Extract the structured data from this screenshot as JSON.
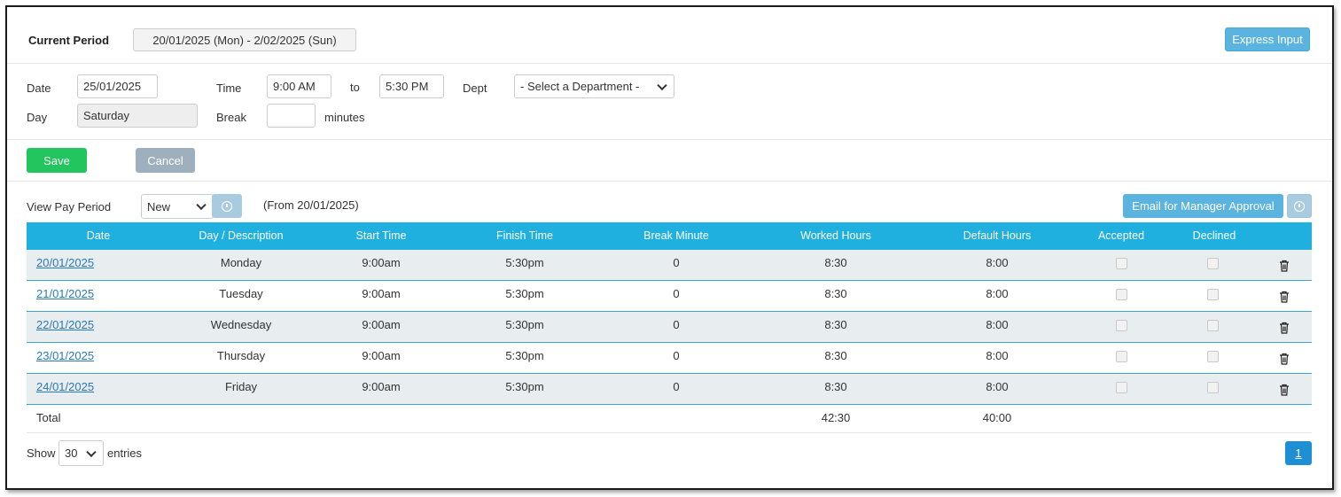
{
  "header": {
    "current_period_label": "Current Period",
    "current_period_value": "20/01/2025 (Mon) - 2/02/2025 (Sun)",
    "express_input": "Express Input"
  },
  "form": {
    "date_label": "Date",
    "date_value": "25/01/2025",
    "day_label": "Day",
    "day_value": "Saturday",
    "time_label": "Time",
    "time_start": "9:00 AM",
    "to_label": "to",
    "time_end": "5:30 PM",
    "dept_label": "Dept",
    "dept_value": "- Select a Department -",
    "break_label": "Break",
    "break_value": "",
    "minutes_label": "minutes"
  },
  "actions": {
    "save": "Save",
    "cancel": "Cancel"
  },
  "pay_period": {
    "label": "View Pay Period",
    "selected": "New",
    "from_text": "(From 20/01/2025)",
    "email_button": "Email for Manager Approval"
  },
  "table": {
    "headers": [
      "Date",
      "Day / Description",
      "Start Time",
      "Finish Time",
      "Break Minute",
      "Worked Hours",
      "Default Hours",
      "Accepted",
      "Declined"
    ],
    "rows": [
      {
        "date": "20/01/2025",
        "day": "Monday",
        "start": "9:00am",
        "finish": "5:30pm",
        "break": "0",
        "worked": "8:30",
        "default": "8:00"
      },
      {
        "date": "21/01/2025",
        "day": "Tuesday",
        "start": "9:00am",
        "finish": "5:30pm",
        "break": "0",
        "worked": "8:30",
        "default": "8:00"
      },
      {
        "date": "22/01/2025",
        "day": "Wednesday",
        "start": "9:00am",
        "finish": "5:30pm",
        "break": "0",
        "worked": "8:30",
        "default": "8:00"
      },
      {
        "date": "23/01/2025",
        "day": "Thursday",
        "start": "9:00am",
        "finish": "5:30pm",
        "break": "0",
        "worked": "8:30",
        "default": "8:00"
      },
      {
        "date": "24/01/2025",
        "day": "Friday",
        "start": "9:00am",
        "finish": "5:30pm",
        "break": "0",
        "worked": "8:30",
        "default": "8:00"
      }
    ],
    "total_label": "Total",
    "total_worked": "42:30",
    "total_default": "40:00"
  },
  "footer": {
    "show_label": "Show",
    "entries_value": "30",
    "entries_label": "entries",
    "page": "1"
  },
  "colors": {
    "header_blue": "#1fb0e0",
    "save_green": "#22c55e",
    "link_blue": "#2a7ab8",
    "page_blue": "#1d8fd2"
  },
  "icons": [
    "info-icon",
    "chevron-down-icon",
    "trash-icon"
  ]
}
